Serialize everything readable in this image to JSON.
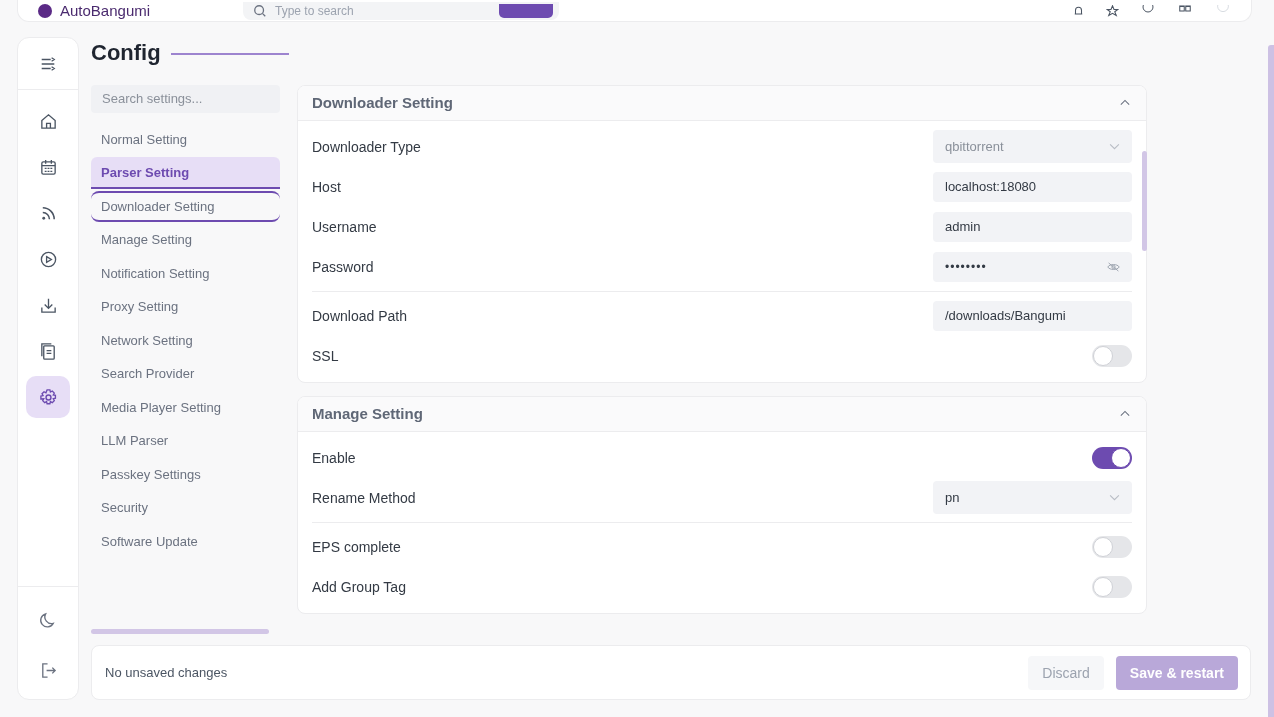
{
  "header": {
    "app_name": "AutoBangumi",
    "search": {
      "placeholder": "Type to search"
    }
  },
  "page": {
    "title": "Config"
  },
  "settings_nav": {
    "search": {
      "placeholder": "Search settings..."
    },
    "items": [
      {
        "label": "Normal Setting",
        "selected": false,
        "outlined": false
      },
      {
        "label": "Parser Setting",
        "selected": true,
        "outlined": false
      },
      {
        "label": "Downloader Setting",
        "selected": false,
        "outlined": true
      },
      {
        "label": "Manage Setting",
        "selected": false,
        "outlined": false
      },
      {
        "label": "Notification Setting",
        "selected": false,
        "outlined": false
      },
      {
        "label": "Proxy Setting",
        "selected": false,
        "outlined": false
      },
      {
        "label": "Network Setting",
        "selected": false,
        "outlined": false
      },
      {
        "label": "Search Provider",
        "selected": false,
        "outlined": false
      },
      {
        "label": "Media Player Setting",
        "selected": false,
        "outlined": false
      },
      {
        "label": "LLM Parser",
        "selected": false,
        "outlined": false
      },
      {
        "label": "Passkey Settings",
        "selected": false,
        "outlined": false
      },
      {
        "label": "Security",
        "selected": false,
        "outlined": false
      },
      {
        "label": "Software Update",
        "selected": false,
        "outlined": false
      }
    ]
  },
  "sections": [
    {
      "title": "Downloader Setting",
      "expanded": true,
      "rows": [
        {
          "kind": "select",
          "label": "Downloader Type",
          "value": "qbittorrent",
          "disabled": true,
          "separated": false
        },
        {
          "kind": "text",
          "label": "Host",
          "value": "localhost:18080",
          "separated": false
        },
        {
          "kind": "text",
          "label": "Username",
          "value": "admin",
          "separated": false
        },
        {
          "kind": "password",
          "label": "Password",
          "value": "••••••••",
          "separated": false
        },
        {
          "kind": "text",
          "label": "Download Path",
          "value": "/downloads/Bangumi",
          "separated": true
        },
        {
          "kind": "toggle",
          "label": "SSL",
          "on": false,
          "separated": false
        }
      ]
    },
    {
      "title": "Manage Setting",
      "expanded": true,
      "rows": [
        {
          "kind": "toggle",
          "label": "Enable",
          "on": true,
          "separated": false
        },
        {
          "kind": "select",
          "label": "Rename Method",
          "value": "pn",
          "disabled": false,
          "separated": false
        },
        {
          "kind": "toggle",
          "label": "EPS complete",
          "on": false,
          "separated": true
        },
        {
          "kind": "toggle",
          "label": "Add Group Tag",
          "on": false,
          "separated": false
        }
      ]
    }
  ],
  "footer": {
    "status": "No unsaved changes",
    "buttons": [
      {
        "label": "Discard",
        "kind": "secondary",
        "disabled": true
      },
      {
        "label": "Save & restart",
        "kind": "primary",
        "disabled": true
      }
    ]
  }
}
